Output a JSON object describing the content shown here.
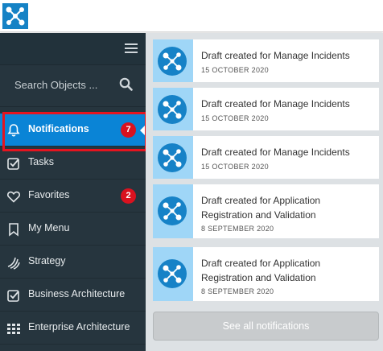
{
  "colors": {
    "accent": "#0a84d6",
    "sidebar_bg": "#26353e",
    "badge": "#d9121f",
    "highlight": "#e5141f",
    "thumb_bg": "#9fd6f7"
  },
  "topbar": {
    "logo_icon": "network-logo-icon"
  },
  "sidebar": {
    "menu_icon": "hamburger-icon",
    "search": {
      "placeholder": "Search Objects ...",
      "icon": "search-icon"
    },
    "items": [
      {
        "label": "Notifications",
        "icon": "bell-icon",
        "badge": "7",
        "active": true
      },
      {
        "label": "Tasks",
        "icon": "checkbox-icon"
      },
      {
        "label": "Favorites",
        "icon": "heart-icon",
        "badge": "2"
      },
      {
        "label": "My Menu",
        "icon": "bookmark-icon"
      },
      {
        "label": "Strategy",
        "icon": "strategy-icon"
      },
      {
        "label": "Business Architecture",
        "icon": "checkbox-icon"
      },
      {
        "label": "Enterprise Architecture",
        "icon": "grid-icon"
      }
    ]
  },
  "notifications": [
    {
      "title": "Draft created for Manage Incidents",
      "date": "15 OCTOBER 2020"
    },
    {
      "title": "Draft created for Manage Incidents",
      "date": "15 OCTOBER 2020"
    },
    {
      "title": "Draft created for Manage Incidents",
      "date": "15 OCTOBER 2020"
    },
    {
      "title": "Draft created for Application Registration and Validation",
      "date": "8 SEPTEMBER 2020"
    },
    {
      "title": "Draft created for Application Registration and Validation",
      "date": "8 SEPTEMBER 2020"
    }
  ],
  "see_all_label": "See all notifications"
}
